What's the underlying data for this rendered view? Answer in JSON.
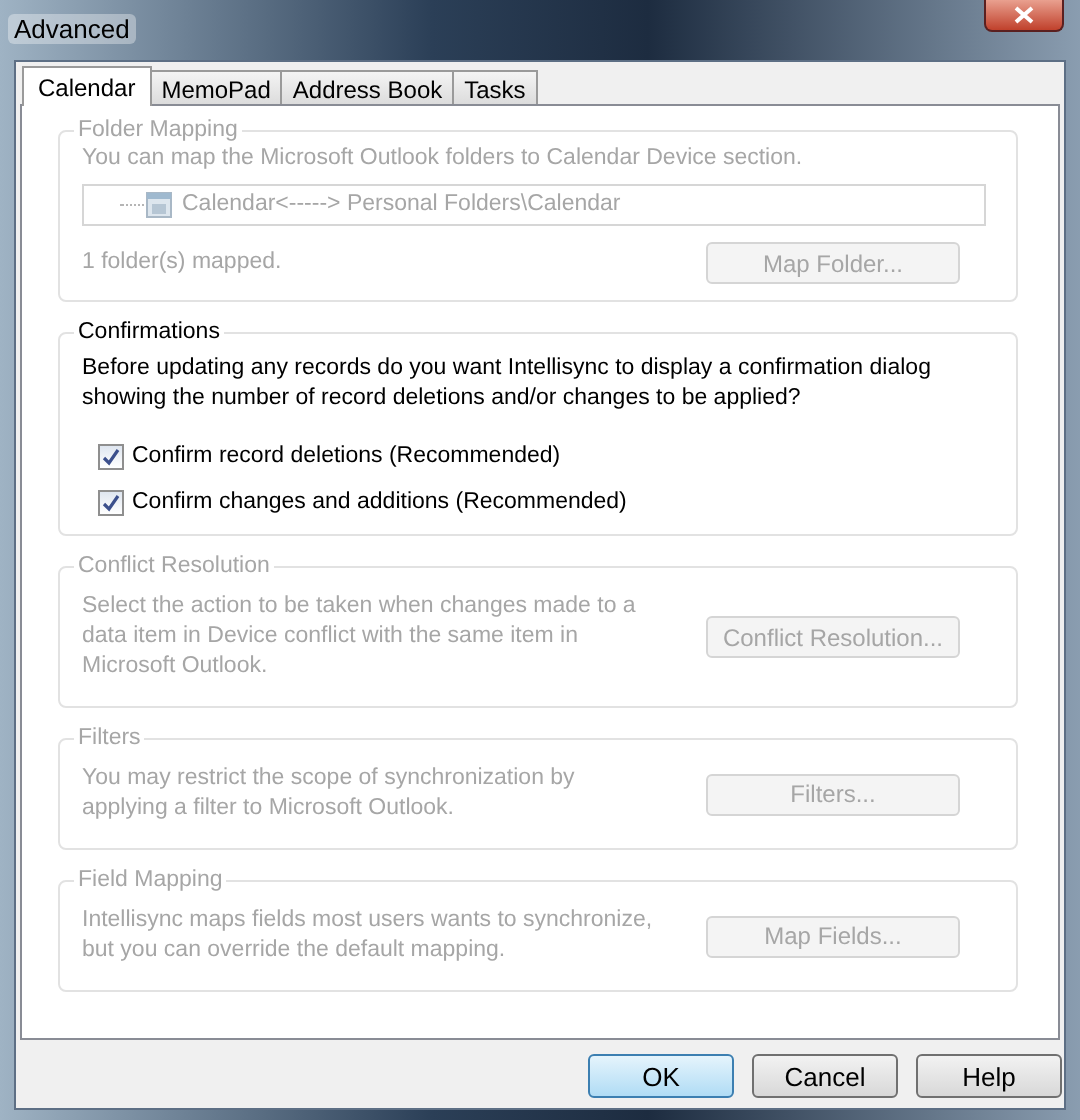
{
  "window": {
    "title": "Advanced"
  },
  "tabs": [
    {
      "label": "Calendar",
      "selected": true
    },
    {
      "label": "MemoPad",
      "selected": false
    },
    {
      "label": "Address Book",
      "selected": false
    },
    {
      "label": "Tasks",
      "selected": false
    }
  ],
  "groups": [
    {
      "kind": "folder_mapping",
      "title": "Folder Mapping",
      "disabled": true,
      "description": "You can map the Microsoft Outlook folders to Calendar Device section.",
      "mapping": "Calendar<-----> Personal Folders\\Calendar",
      "status": "1 folder(s) mapped.",
      "button": "Map Folder..."
    },
    {
      "kind": "confirmations",
      "title": "Confirmations",
      "disabled": false,
      "description": "Before updating any records do you want Intellisync to display a confirmation dialog showing the number of record deletions and/or changes to be applied?",
      "checkboxes": [
        {
          "label": "Confirm record deletions (Recommended)",
          "checked": true
        },
        {
          "label": "Confirm changes and additions (Recommended)",
          "checked": true
        }
      ]
    },
    {
      "kind": "action",
      "title": "Conflict Resolution",
      "disabled": true,
      "description": "Select the action to be taken when changes made to a data item in Device conflict with the same item in Microsoft Outlook.",
      "button": "Conflict Resolution..."
    },
    {
      "kind": "action",
      "title": "Filters",
      "disabled": true,
      "description": "You may restrict the scope of synchronization by applying a filter to Microsoft Outlook.",
      "button": "Filters..."
    },
    {
      "kind": "action",
      "title": "Field Mapping",
      "disabled": true,
      "description": "Intellisync maps fields most users wants to synchronize, but you can override the default mapping.",
      "button": "Map Fields..."
    }
  ],
  "buttons": [
    {
      "label": "OK",
      "default": true
    },
    {
      "label": "Cancel",
      "default": false
    },
    {
      "label": "Help",
      "default": false
    }
  ]
}
